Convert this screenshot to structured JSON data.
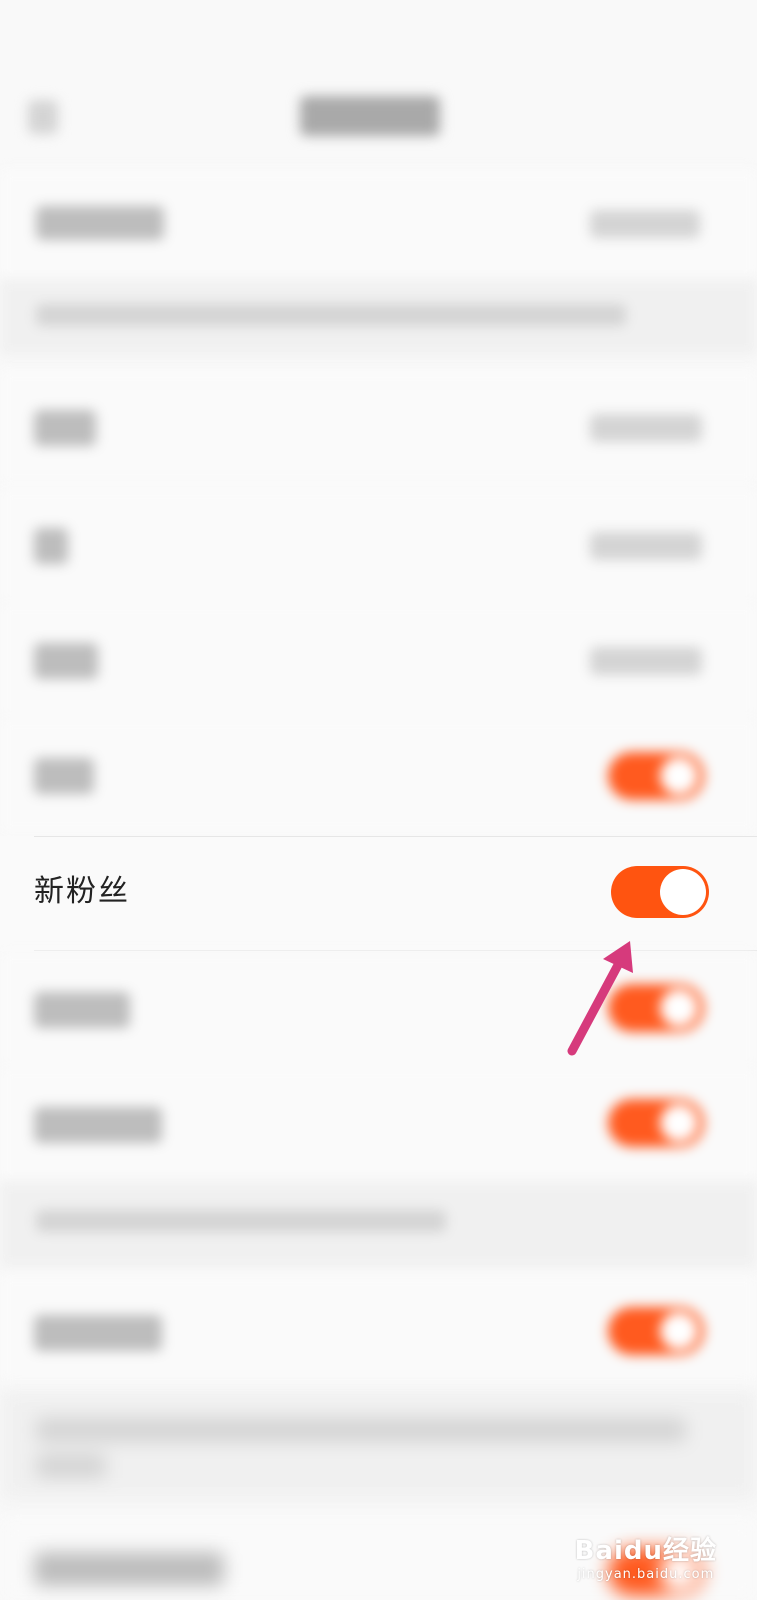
{
  "focused_row": {
    "label": "新粉丝",
    "toggle_on": true
  },
  "watermark": {
    "logo_text": "Baidu经验",
    "url_text": "jingyan.baidu.com"
  },
  "colors": {
    "toggle_on": "#ff5410",
    "arrow": "#d63a7c",
    "background": "#f9f9f9"
  }
}
